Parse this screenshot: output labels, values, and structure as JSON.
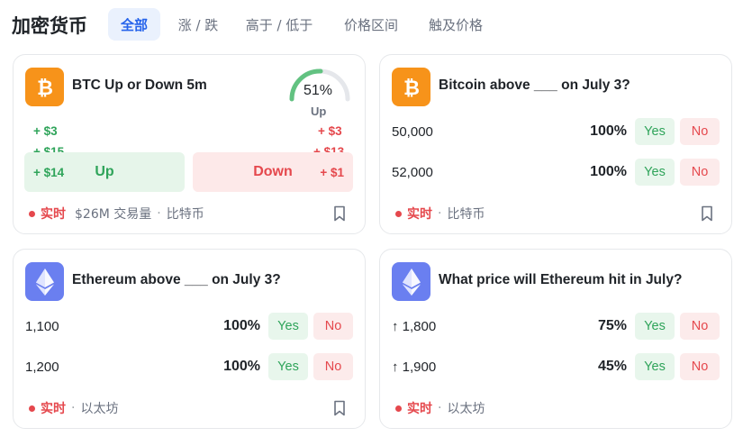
{
  "page": {
    "title": "加密货币",
    "tabs": [
      {
        "label": "全部",
        "active": true
      },
      {
        "label": "涨 / 跌",
        "active": false
      },
      {
        "label": "高于 / 低于",
        "active": false
      },
      {
        "label": "价格区间",
        "active": false
      },
      {
        "label": "触及价格",
        "active": false
      }
    ]
  },
  "colors": {
    "accent": "#2563eb",
    "yes": "#2fa45a",
    "no": "#e5484d",
    "btc": "#f7931a",
    "eth": "#6a7ff0"
  },
  "cards": [
    {
      "icon": "bitcoin-icon",
      "title": "BTC Up or Down 5m",
      "gauge": {
        "value": "51%",
        "fraction": 0.51,
        "label": "Up"
      },
      "up_tickers": [
        "+ $3",
        "+ $15",
        "+ $14"
      ],
      "down_tickers": [
        "+ $3",
        "+ $13",
        "+ $1"
      ],
      "up_label": "Up",
      "down_label": "Down",
      "live": "实时",
      "volume": "$26M 交易量",
      "category": "比特币"
    },
    {
      "icon": "bitcoin-icon",
      "title": "Bitcoin above ___ on July 3?",
      "rows": [
        {
          "label": "50,000",
          "pct": "100%",
          "yes": "Yes",
          "no": "No"
        },
        {
          "label": "52,000",
          "pct": "100%",
          "yes": "Yes",
          "no": "No"
        }
      ],
      "live": "实时",
      "category": "比特币"
    },
    {
      "icon": "ethereum-icon",
      "title": "Ethereum above ___ on July 3?",
      "rows": [
        {
          "label": "1,100",
          "pct": "100%",
          "yes": "Yes",
          "no": "No"
        },
        {
          "label": "1,200",
          "pct": "100%",
          "yes": "Yes",
          "no": "No"
        }
      ],
      "live": "实时",
      "category": "以太坊"
    },
    {
      "icon": "ethereum-icon",
      "title": "What price will Ethereum hit in July?",
      "rows": [
        {
          "label": "↑ 1,800",
          "pct": "75%",
          "yes": "Yes",
          "no": "No"
        },
        {
          "label": "↑ 1,900",
          "pct": "45%",
          "yes": "Yes",
          "no": "No"
        }
      ],
      "live": "实时",
      "category": "以太坊"
    }
  ]
}
